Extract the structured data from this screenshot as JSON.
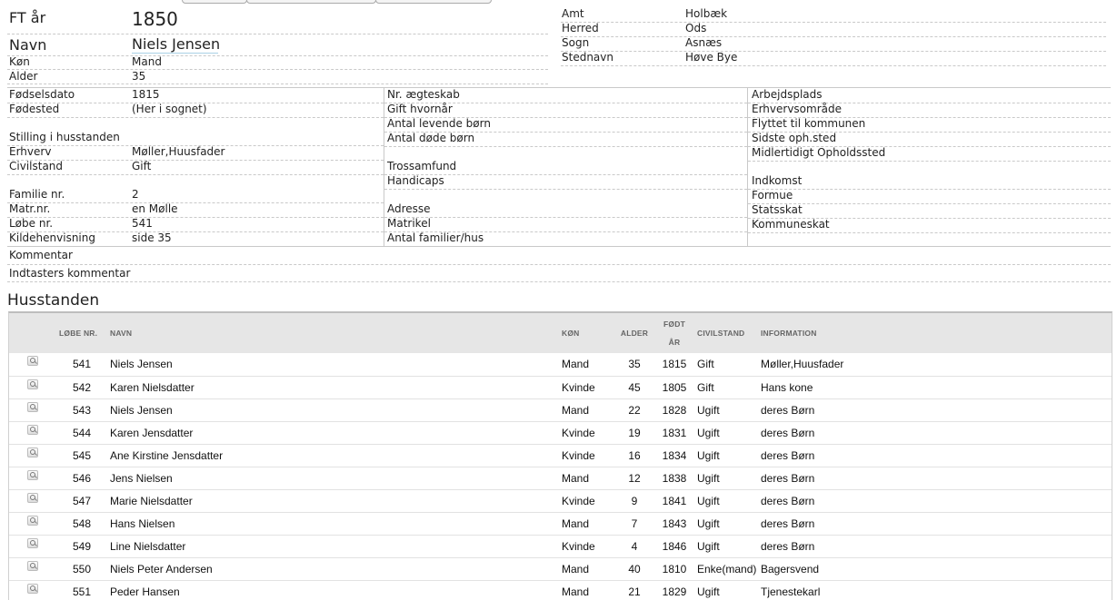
{
  "record": {
    "ft_label": "FT år",
    "ft_year": "1850",
    "navn_label": "Navn",
    "navn": "Niels Jensen",
    "koen_label": "Køn",
    "koen": "Mand",
    "alder_label": "Alder",
    "alder": "35"
  },
  "location": {
    "amt_label": "Amt",
    "amt": "Holbæk",
    "herred_label": "Herred",
    "herred": "Ods",
    "sogn_label": "Sogn",
    "sogn": "Asnæs",
    "stednavn_label": "Stednavn",
    "stednavn": "Høve Bye"
  },
  "col1": {
    "foedselsdato_label": "Fødselsdato",
    "foedselsdato": "1815",
    "foedested_label": "Fødested",
    "foedested": "(Her i sognet)",
    "stilling_label": "Stilling i husstanden",
    "erhverv_label": "Erhverv",
    "erhverv": "Møller,Huusfader",
    "civilstand_label": "Civilstand",
    "civilstand": "Gift",
    "familie_label": "Familie nr.",
    "familie": "2",
    "matr_label": "Matr.nr.",
    "matr": "en Mølle",
    "loebe_label": "Løbe nr.",
    "loebe": "541",
    "kilde_label": "Kildehenvisning",
    "kilde": "side 35"
  },
  "col2": {
    "aegteskab_label": "Nr. ægteskab",
    "gift_label": "Gift hvornår",
    "levende_label": "Antal levende børn",
    "doede_label": "Antal døde børn",
    "tros_label": "Trossamfund",
    "handicaps_label": "Handicaps",
    "adresse_label": "Adresse",
    "matrikel_label": "Matrikel",
    "familier_label": "Antal familier/hus"
  },
  "col3": {
    "arbejdsplads_label": "Arbejdsplads",
    "erhvervsomraade_label": "Erhvervsområde",
    "flyttet_label": "Flyttet til kommunen",
    "sidste_label": "Sidste oph.sted",
    "midlertidigt_label": "Midlertidigt Opholdssted",
    "indkomst_label": "Indkomst",
    "formue_label": "Formue",
    "statsskat_label": "Statsskat",
    "kommuneskat_label": "Kommuneskat"
  },
  "comments": {
    "kommentar_label": "Kommentar",
    "indtaster_label": "Indtasters kommentar"
  },
  "household": {
    "title": "Husstanden",
    "headers": {
      "loebe": "LØBE NR.",
      "navn": "NAVN",
      "koen": "KØN",
      "alder": "ALDER",
      "foedt_1": "FØDT",
      "foedt_2": "ÅR",
      "civilstand": "CIVILSTAND",
      "information": "INFORMATION"
    },
    "rows": [
      {
        "nr": "541",
        "navn": "Niels Jensen",
        "koen": "Mand",
        "alder": "35",
        "aar": "1815",
        "civil": "Gift",
        "info": "Møller,Huusfader"
      },
      {
        "nr": "542",
        "navn": "Karen Nielsdatter",
        "koen": "Kvinde",
        "alder": "45",
        "aar": "1805",
        "civil": "Gift",
        "info": "Hans kone"
      },
      {
        "nr": "543",
        "navn": "Niels Jensen",
        "koen": "Mand",
        "alder": "22",
        "aar": "1828",
        "civil": "Ugift",
        "info": "deres Børn"
      },
      {
        "nr": "544",
        "navn": "Karen Jensdatter",
        "koen": "Kvinde",
        "alder": "19",
        "aar": "1831",
        "civil": "Ugift",
        "info": "deres Børn"
      },
      {
        "nr": "545",
        "navn": "Ane Kirstine Jensdatter",
        "koen": "Kvinde",
        "alder": "16",
        "aar": "1834",
        "civil": "Ugift",
        "info": "deres Børn"
      },
      {
        "nr": "546",
        "navn": "Jens Nielsen",
        "koen": "Mand",
        "alder": "12",
        "aar": "1838",
        "civil": "Ugift",
        "info": "deres Børn"
      },
      {
        "nr": "547",
        "navn": "Marie Nielsdatter",
        "koen": "Kvinde",
        "alder": "9",
        "aar": "1841",
        "civil": "Ugift",
        "info": "deres Børn"
      },
      {
        "nr": "548",
        "navn": "Hans Nielsen",
        "koen": "Mand",
        "alder": "7",
        "aar": "1843",
        "civil": "Ugift",
        "info": "deres Børn"
      },
      {
        "nr": "549",
        "navn": "Line Nielsdatter",
        "koen": "Kvinde",
        "alder": "4",
        "aar": "1846",
        "civil": "Ugift",
        "info": "deres Børn"
      },
      {
        "nr": "550",
        "navn": "Niels Peter Andersen",
        "koen": "Mand",
        "alder": "40",
        "aar": "1810",
        "civil": "Enke(mand)",
        "info": "Bagersvend"
      },
      {
        "nr": "551",
        "navn": "Peder Hansen",
        "koen": "Mand",
        "alder": "21",
        "aar": "1829",
        "civil": "Ugift",
        "info": "Tjenestekarl"
      }
    ]
  }
}
